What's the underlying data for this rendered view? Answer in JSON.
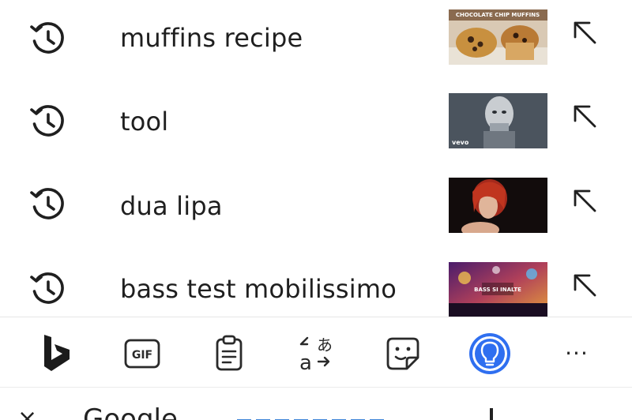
{
  "suggestions": [
    {
      "query": "muffins recipe",
      "thumb_caption": "CHOCOLATE CHIP MUFFINS"
    },
    {
      "query": "tool",
      "thumb_caption": "vevo"
    },
    {
      "query": "dua lipa",
      "thumb_caption": ""
    },
    {
      "query": "bass test mobilissimo",
      "thumb_caption": "BASS SI INALTE"
    }
  ],
  "toolbar": {
    "items": [
      {
        "name": "bing-button",
        "icon": "bing-logo-icon"
      },
      {
        "name": "gif-button",
        "icon": "gif-icon",
        "label": "GIF"
      },
      {
        "name": "clipboard-button",
        "icon": "clipboard-icon"
      },
      {
        "name": "translate-button",
        "icon": "translate-icon"
      },
      {
        "name": "sticker-button",
        "icon": "sticker-icon"
      },
      {
        "name": "ideas-button",
        "icon": "lightbulb-icon",
        "active": true
      },
      {
        "name": "more-button",
        "icon": "more-horizontal-icon",
        "label": "···"
      }
    ],
    "accent_color": "#2f6ff0"
  },
  "bottom_partial": {
    "close_glyph": "×",
    "text": "Google"
  }
}
